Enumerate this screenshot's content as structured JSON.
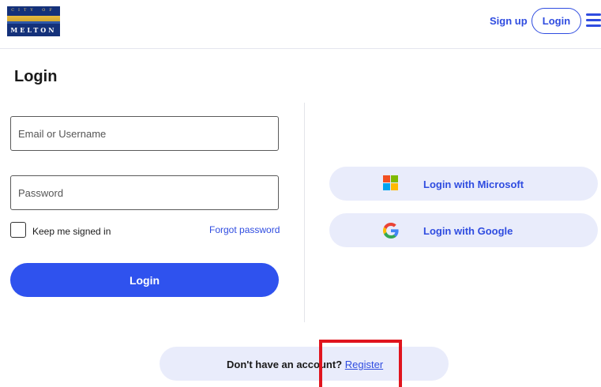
{
  "header": {
    "logo": {
      "city_of": "CITY OF",
      "name": "MELTON"
    },
    "signup_label": "Sign up",
    "login_label": "Login"
  },
  "page": {
    "title": "Login"
  },
  "form": {
    "email_placeholder": "Email or Username",
    "email_value": "",
    "password_placeholder": "Password",
    "password_value": "",
    "keep_signed_in_label": "Keep me signed in",
    "keep_signed_in_checked": false,
    "forgot_password_label": "Forgot password",
    "submit_label": "Login"
  },
  "sso": {
    "microsoft_label": "Login with Microsoft",
    "google_label": "Login with Google"
  },
  "register": {
    "prompt": "Don't have an account?",
    "link_label": "Register"
  },
  "colors": {
    "accent": "#2f4ce0",
    "primary_button": "#2f52ee",
    "pill_background": "#e9ecfb",
    "highlight": "#e0141e"
  },
  "icons": {
    "menu": "hamburger-menu-icon",
    "microsoft": "microsoft-logo-icon",
    "google": "google-logo-icon"
  }
}
